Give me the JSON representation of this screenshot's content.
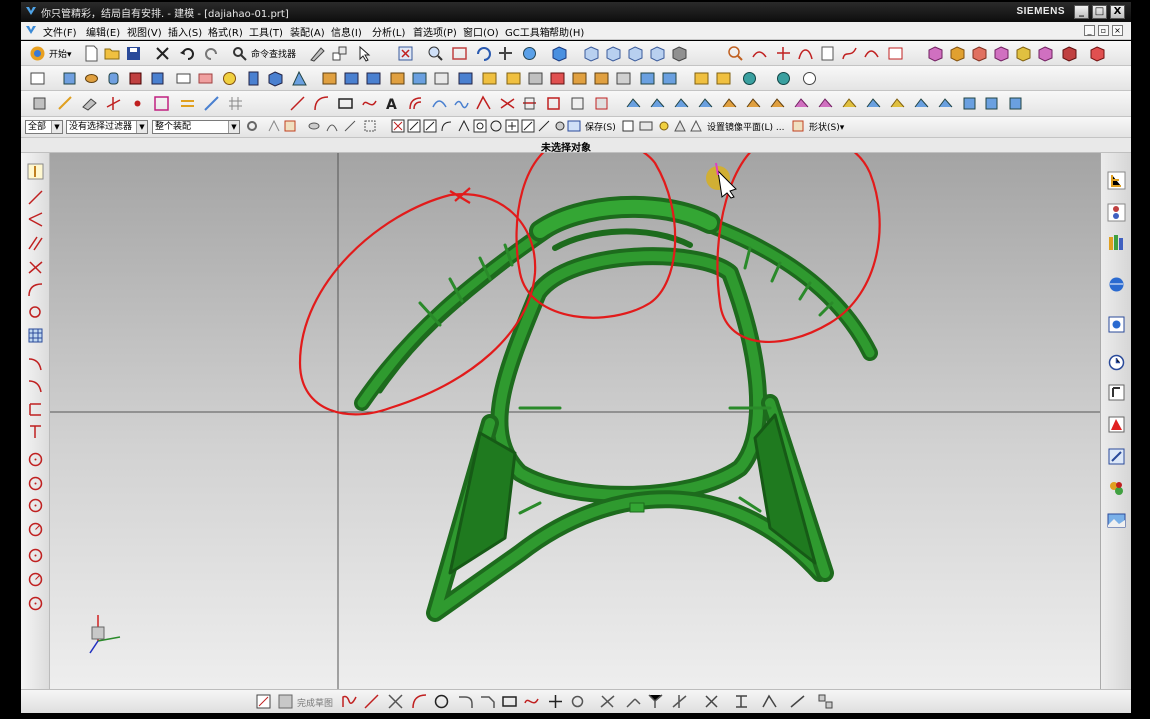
{
  "window": {
    "title": "你只管精彩，结局自有安排. - 建模 - [dajiahao-01.prt]",
    "brand": "SIEMENS",
    "controls": {
      "minimize": "_",
      "maximize": "□",
      "close": "X"
    }
  },
  "menu": {
    "items": [
      "文件(F)",
      "编辑(E)",
      "视图(V)",
      "插入(S)",
      "格式(R)",
      "工具(T)",
      "装配(A)",
      "信息(I)",
      "分析(L)",
      "首选项(P)",
      "窗口(O)",
      "GC工具箱",
      "帮助(H)"
    ]
  },
  "toolbar": {
    "start_label": "开始▾",
    "command_finder_label": "命令查找器"
  },
  "selection_bar": {
    "filter_value": "全部",
    "filter_rule": "没有选择过滤器",
    "scope": "整个装配",
    "save_label": "保存(S)",
    "mirror_plane_label": "设置镜像平面(L) ...",
    "shape_label": "形状(S)▾"
  },
  "status": {
    "cue": "未选择对象"
  },
  "bottom_toolbar": {
    "finish_sketch_label": "完成草图"
  },
  "colors": {
    "model_green": "#1f7a1f",
    "annotation_red": "#e21b1b",
    "cursor_highlight": "#d8b020"
  },
  "icons": {
    "left": [
      "pin-icon",
      "line-icon",
      "arc-icon",
      "parallel-icon",
      "trim-icon",
      "fillet-icon",
      "offset-icon",
      "grid-icon",
      "curve-icon",
      "curve-icon",
      "dimension-icon",
      "dimension-icon",
      "circle-dim-icon",
      "circle-dim-icon",
      "circle-dim-icon",
      "circle-dim-icon",
      "circle-dim-icon",
      "circle-dim-icon",
      "circle-dim-icon"
    ],
    "right": [
      "assembly-navigator-icon",
      "part-navigator-icon",
      "reuse-library-icon",
      "web-browser-icon",
      "history-icon",
      "clock-icon",
      "material-icon",
      "roles-icon",
      "system-materials-icon",
      "palette-icon",
      "image-icon"
    ]
  }
}
